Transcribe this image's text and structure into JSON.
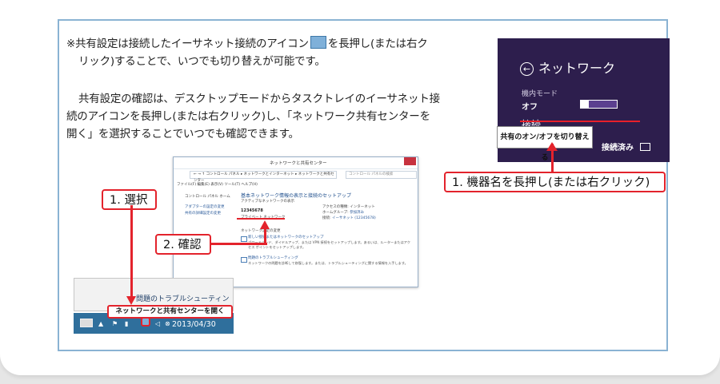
{
  "note": {
    "line1": "※共有設定は接続したイーサネット接続のアイコン",
    "line1b": "を長押し(または右ク",
    "line2": "リック)することで、いつでも切り替えが可能です。",
    "para2_1": "共有設定の確認は、デスクトップモードからタスクトレイのイーサネット接",
    "para2_2": "続のアイコンを長押し(または右クリック)し、「ネットワーク共有センターを",
    "para2_3": "開く」を選択することでいつでも確認できます。"
  },
  "network_panel": {
    "title": "ネットワーク",
    "airplane_label": "機内モード",
    "airplane_value": "オフ",
    "connection_label": "接続",
    "context_menu_item": "共有のオン/オフを切り替える",
    "connection_status": "接続済み"
  },
  "callouts": {
    "long_press": "1. 機器名を長押し(または右クリック)",
    "select": "1. 選択",
    "confirm": "2. 確認"
  },
  "window": {
    "title": "ネットワークと共有センター",
    "address": "← → ↑  コントロール パネル ▸ ネットワークとインターネット ▸ ネットワークと共有センター",
    "search_placeholder": "コントロール パネルの検索",
    "menu": "ファイル(F)  編集(E)  表示(V)  ツール(T)  ヘルプ(H)",
    "side1": "コントロール パネル ホーム",
    "side2": "アダプターの設定の変更",
    "side3": "共有の詳細設定の変更",
    "heading": "基本ネットワーク情報の表示と接続のセットアップ",
    "active_networks": "アクティブなネットワークの表示",
    "network_name": "12345678",
    "network_type": "プライベート ネットワーク",
    "access_type_label": "アクセスの種類:",
    "access_type_value": "インターネット",
    "homegroup_label": "ホームグループ:",
    "homegroup_value": "参加済み",
    "connections_label": "接続:",
    "connections_value": "イーサネット (12345678)",
    "change_settings": "ネットワーク設定の変更",
    "task1_title": "新しい接続またはネットワークのセットアップ",
    "task1_desc": "ブロードバンド、ダイヤルアップ、または VPN 接続をセットアップします。あるいは、ルーターまたはアクセス ポイントをセットアップします。",
    "task2_title": "問題のトラブルシューティング",
    "task2_desc": "ネットワークの問題を診断して修復します。または、トラブルシューティングに関する情報を入手します。"
  },
  "taskbar": {
    "menu_troubleshoot": "問題のトラブルシューティング",
    "menu_open_center": "ネットワークと共有センターを開く",
    "date": "2013/04/30"
  }
}
